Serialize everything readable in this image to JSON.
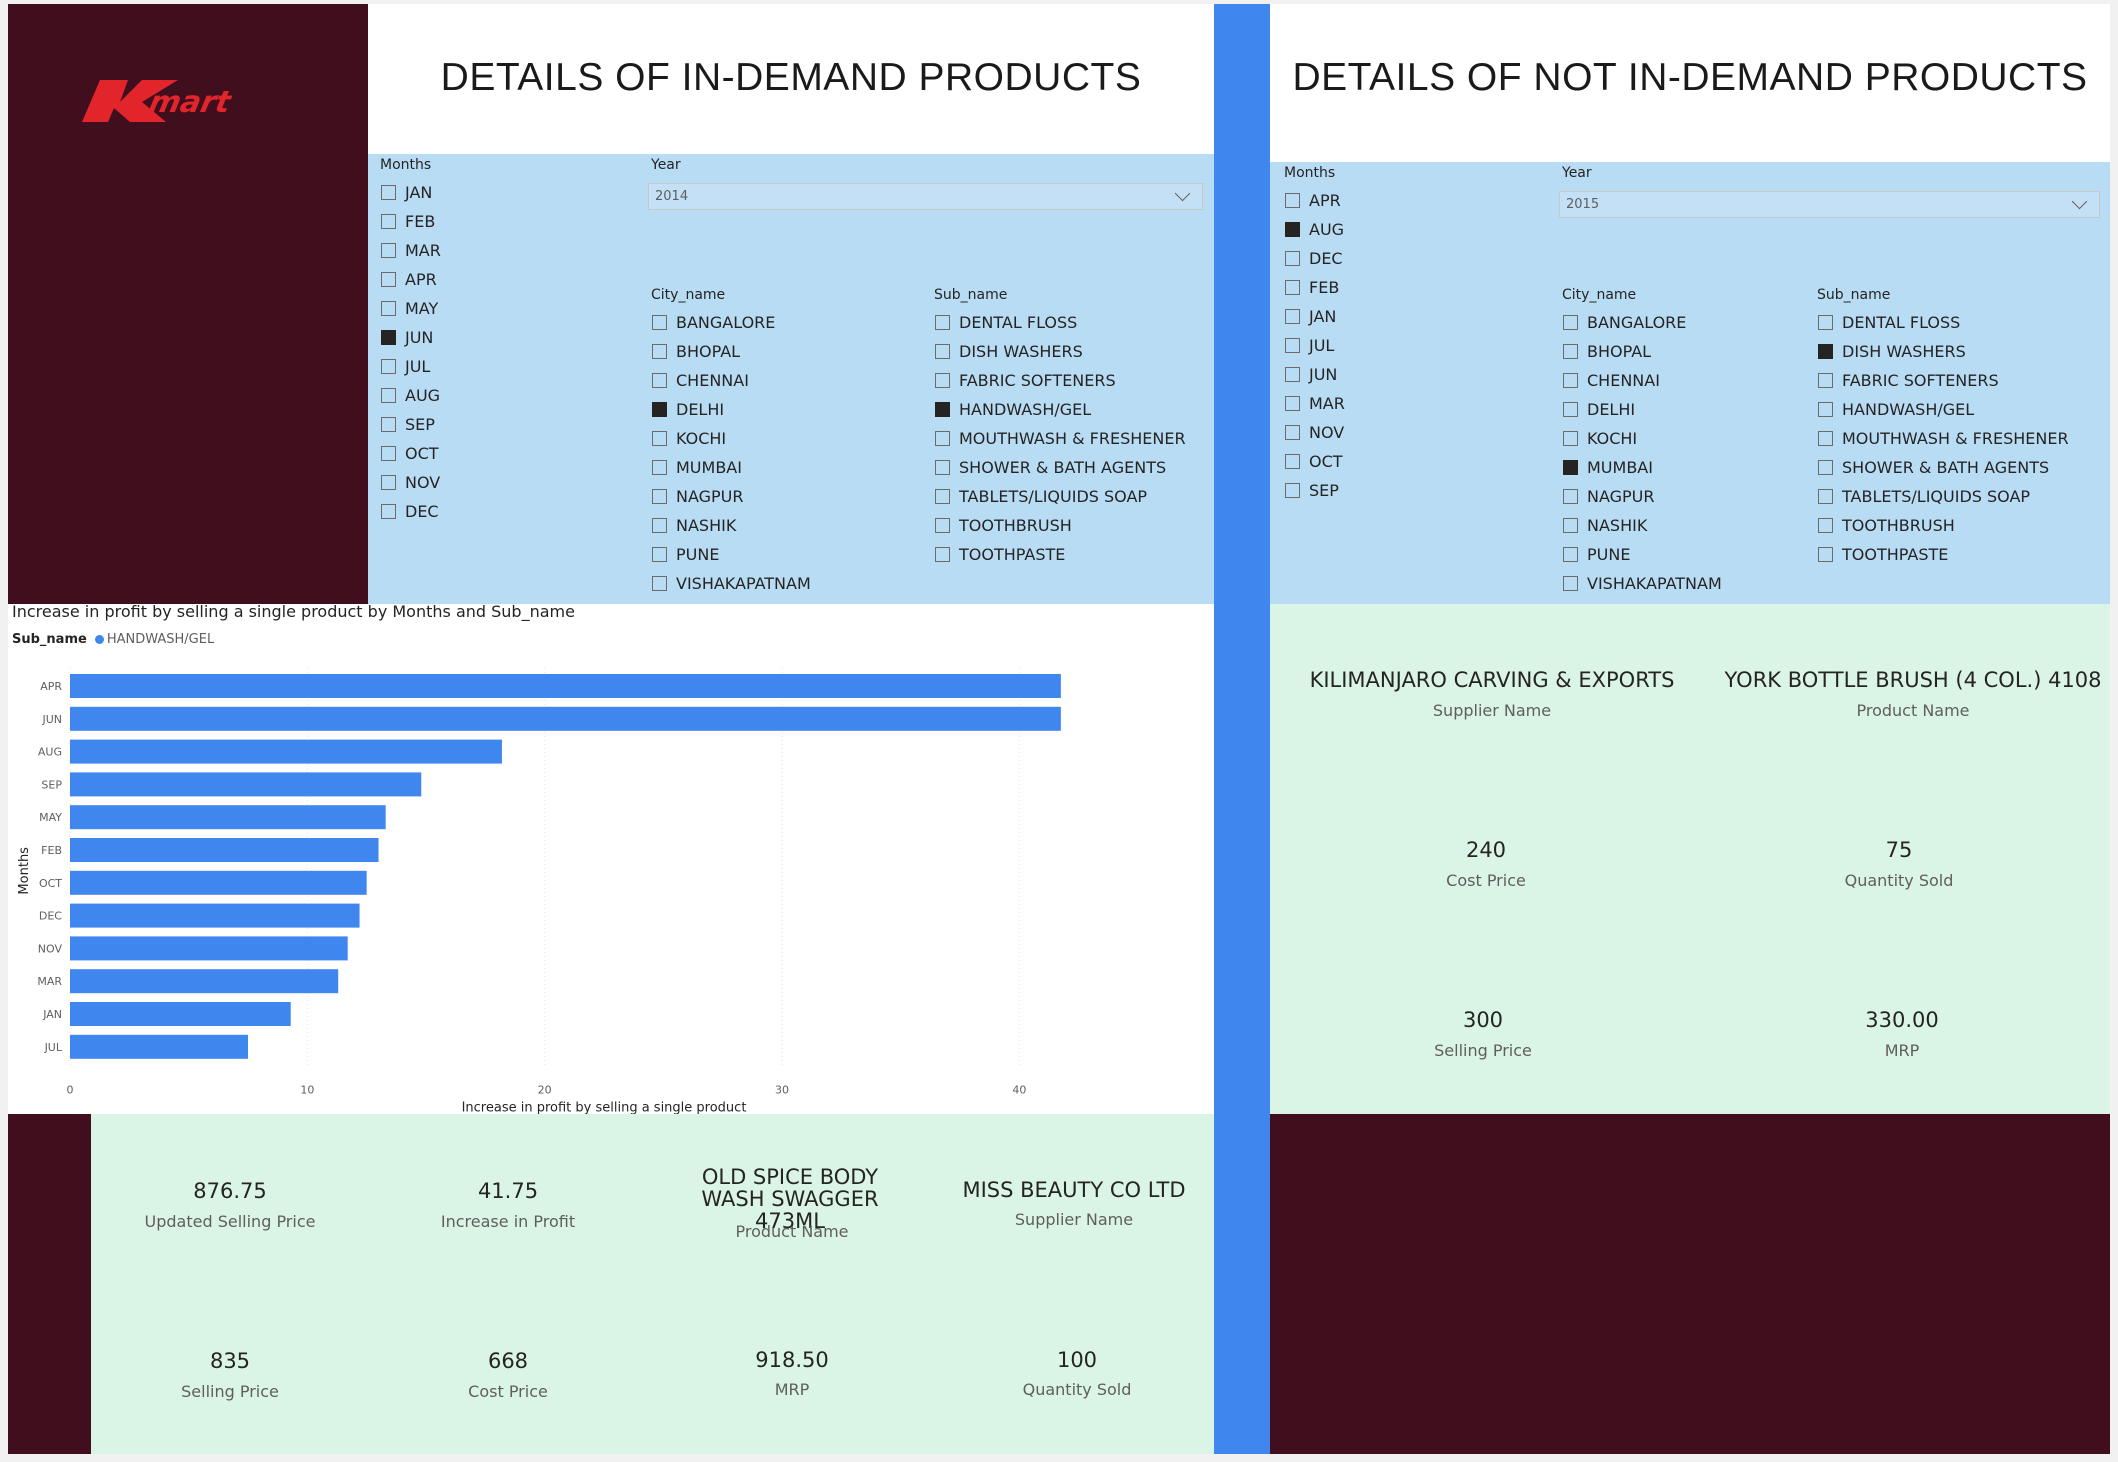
{
  "logo": {
    "text": "Kmart"
  },
  "left": {
    "title": "DETAILS OF IN-DEMAND PRODUCTS",
    "months_slicer": {
      "header": "Months",
      "items": [
        {
          "label": "JAN",
          "checked": false
        },
        {
          "label": "FEB",
          "checked": false
        },
        {
          "label": "MAR",
          "checked": false
        },
        {
          "label": "APR",
          "checked": false
        },
        {
          "label": "MAY",
          "checked": false
        },
        {
          "label": "JUN",
          "checked": true
        },
        {
          "label": "JUL",
          "checked": false
        },
        {
          "label": "AUG",
          "checked": false
        },
        {
          "label": "SEP",
          "checked": false
        },
        {
          "label": "OCT",
          "checked": false
        },
        {
          "label": "NOV",
          "checked": false
        },
        {
          "label": "DEC",
          "checked": false
        }
      ]
    },
    "year_slicer": {
      "header": "Year",
      "value": "2014"
    },
    "city_slicer": {
      "header": "City_name",
      "items": [
        {
          "label": "BANGALORE",
          "checked": false
        },
        {
          "label": "BHOPAL",
          "checked": false
        },
        {
          "label": "CHENNAI",
          "checked": false
        },
        {
          "label": "DELHI",
          "checked": true
        },
        {
          "label": "KOCHI",
          "checked": false
        },
        {
          "label": "MUMBAI",
          "checked": false
        },
        {
          "label": "NAGPUR",
          "checked": false
        },
        {
          "label": "NASHIK",
          "checked": false
        },
        {
          "label": "PUNE",
          "checked": false
        },
        {
          "label": "VISHAKAPATNAM",
          "checked": false
        }
      ]
    },
    "sub_slicer": {
      "header": "Sub_name",
      "items": [
        {
          "label": "DENTAL FLOSS",
          "checked": false
        },
        {
          "label": "DISH WASHERS",
          "checked": false
        },
        {
          "label": "FABRIC SOFTENERS",
          "checked": false
        },
        {
          "label": "HANDWASH/GEL",
          "checked": true
        },
        {
          "label": "MOUTHWASH & FRESHENER",
          "checked": false
        },
        {
          "label": "SHOWER & BATH AGENTS",
          "checked": false
        },
        {
          "label": "TABLETS/LIQUIDS SOAP",
          "checked": false
        },
        {
          "label": "TOOTHBRUSH",
          "checked": false
        },
        {
          "label": "TOOTHPASTE",
          "checked": false
        }
      ]
    },
    "cards": {
      "updated_selling_price": {
        "value": "876.75",
        "label": "Updated Selling Price"
      },
      "increase_in_profit": {
        "value": "41.75",
        "label": "Increase in Profit"
      },
      "product_name": {
        "value": "OLD SPICE BODY WASH SWAGGER 473ML",
        "label": "Product Name"
      },
      "supplier_name": {
        "value": "MISS BEAUTY CO LTD",
        "label": "Supplier Name"
      },
      "selling_price": {
        "value": "835",
        "label": "Selling Price"
      },
      "cost_price": {
        "value": "668",
        "label": "Cost Price"
      },
      "mrp": {
        "value": "918.50",
        "label": "MRP"
      },
      "quantity_sold": {
        "value": "100",
        "label": "Quantity Sold"
      }
    }
  },
  "right": {
    "title": "DETAILS OF NOT IN-DEMAND PRODUCTS",
    "months_slicer": {
      "header": "Months",
      "items": [
        {
          "label": "APR",
          "checked": false
        },
        {
          "label": "AUG",
          "checked": true
        },
        {
          "label": "DEC",
          "checked": false
        },
        {
          "label": "FEB",
          "checked": false
        },
        {
          "label": "JAN",
          "checked": false
        },
        {
          "label": "JUL",
          "checked": false
        },
        {
          "label": "JUN",
          "checked": false
        },
        {
          "label": "MAR",
          "checked": false
        },
        {
          "label": "NOV",
          "checked": false
        },
        {
          "label": "OCT",
          "checked": false
        },
        {
          "label": "SEP",
          "checked": false
        }
      ]
    },
    "year_slicer": {
      "header": "Year",
      "value": "2015"
    },
    "city_slicer": {
      "header": "City_name",
      "items": [
        {
          "label": "BANGALORE",
          "checked": false
        },
        {
          "label": "BHOPAL",
          "checked": false
        },
        {
          "label": "CHENNAI",
          "checked": false
        },
        {
          "label": "DELHI",
          "checked": false
        },
        {
          "label": "KOCHI",
          "checked": false
        },
        {
          "label": "MUMBAI",
          "checked": true
        },
        {
          "label": "NAGPUR",
          "checked": false
        },
        {
          "label": "NASHIK",
          "checked": false
        },
        {
          "label": "PUNE",
          "checked": false
        },
        {
          "label": "VISHAKAPATNAM",
          "checked": false
        }
      ]
    },
    "sub_slicer": {
      "header": "Sub_name",
      "items": [
        {
          "label": "DENTAL FLOSS",
          "checked": false
        },
        {
          "label": "DISH WASHERS",
          "checked": true
        },
        {
          "label": "FABRIC SOFTENERS",
          "checked": false
        },
        {
          "label": "HANDWASH/GEL",
          "checked": false
        },
        {
          "label": "MOUTHWASH & FRESHENER",
          "checked": false
        },
        {
          "label": "SHOWER & BATH AGENTS",
          "checked": false
        },
        {
          "label": "TABLETS/LIQUIDS SOAP",
          "checked": false
        },
        {
          "label": "TOOTHBRUSH",
          "checked": false
        },
        {
          "label": "TOOTHPASTE",
          "checked": false
        }
      ]
    },
    "cards": {
      "supplier_name": {
        "value": "KILIMANJARO CARVING & EXPORTS",
        "label": "Supplier Name"
      },
      "product_name": {
        "value": "YORK BOTTLE BRUSH (4 COL.) 4108",
        "label": "Product Name"
      },
      "cost_price": {
        "value": "240",
        "label": "Cost Price"
      },
      "quantity_sold": {
        "value": "75",
        "label": "Quantity Sold"
      },
      "selling_price": {
        "value": "300",
        "label": "Selling Price"
      },
      "mrp": {
        "value": "330.00",
        "label": "MRP"
      }
    }
  },
  "chart_data": {
    "type": "bar",
    "orientation": "horizontal",
    "title": "Increase in profit by selling a single product by Months and Sub_name",
    "legend_title": "Sub_name",
    "legend_placement": "top-left",
    "series": [
      {
        "name": "HANDWASH/GEL",
        "color": "#3f87ef",
        "values": [
          41.75,
          41.75,
          18.2,
          14.8,
          13.3,
          13.0,
          12.5,
          12.2,
          11.7,
          11.3,
          9.3,
          7.5
        ]
      }
    ],
    "categories": [
      "APR",
      "JUN",
      "AUG",
      "SEP",
      "MAY",
      "FEB",
      "OCT",
      "DEC",
      "NOV",
      "MAR",
      "JAN",
      "JUL"
    ],
    "xlabel": "Increase in profit by selling a single product",
    "ylabel": "Months",
    "xlim": [
      0,
      45
    ],
    "xticks": [
      "0",
      "10",
      "20",
      "30",
      "40"
    ],
    "grid": true
  }
}
